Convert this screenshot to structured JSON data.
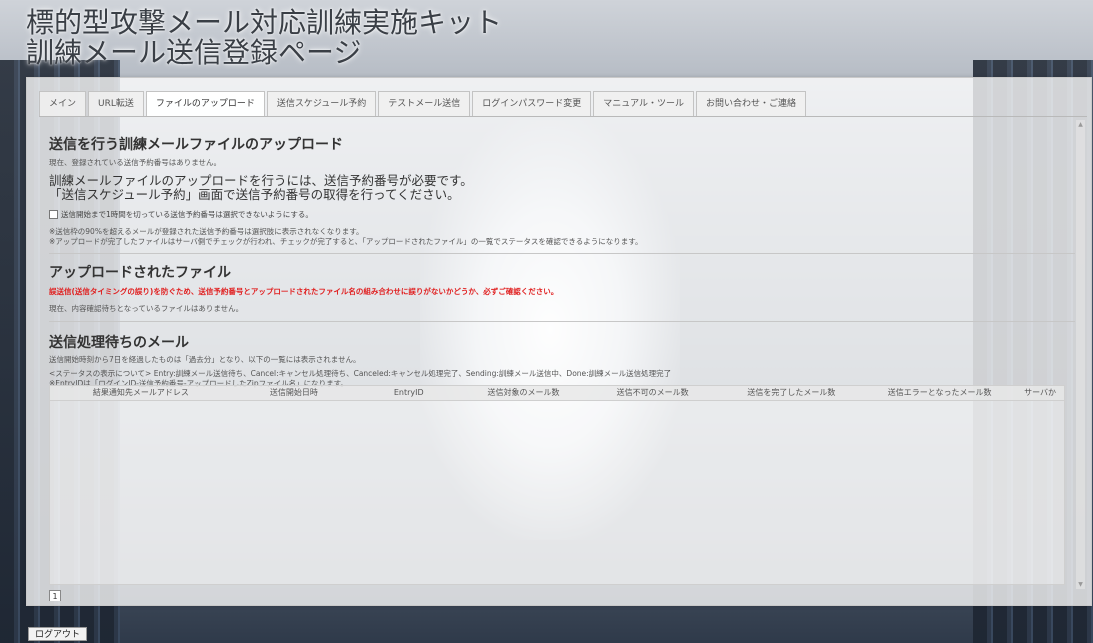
{
  "site": {
    "title_line1": "標的型攻撃メール対応訓練実施キット",
    "title_line2": "訓練メール送信登録ページ"
  },
  "tabs": [
    {
      "label": "メイン"
    },
    {
      "label": "URL転送"
    },
    {
      "label": "ファイルのアップロード",
      "active": true
    },
    {
      "label": "送信スケジュール予約"
    },
    {
      "label": "テストメール送信"
    },
    {
      "label": "ログインパスワード変更"
    },
    {
      "label": "マニュアル・ツール"
    },
    {
      "label": "お問い合わせ・ご連絡"
    }
  ],
  "upload_section": {
    "heading": "送信を行う訓練メールファイルのアップロード",
    "no_reservation": "現在、登録されている送信予約番号はありません。",
    "notice_line1": "訓練メールファイルのアップロードを行うには、送信予約番号が必要です。",
    "notice_line2": "「送信スケジュール予約」画面で送信予約番号の取得を行ってください。",
    "checkbox_label": "送信開始まで1時間を切っている送信予約番号は選択できないようにする。",
    "note1": "※送信枠の90%を超えるメールが登録された送信予約番号は選択肢に表示されなくなります。",
    "note2": "※アップロードが完了したファイルはサーバ側でチェックが行われ、チェックが完了すると、「アップロードされたファイル」の一覧でステータスを確認できるようになります。"
  },
  "uploaded_section": {
    "heading": "アップロードされたファイル",
    "warning": "誤送信(送信タイミングの誤り)を防ぐため、送信予約番号とアップロードされたファイル名の組み合わせに誤りがないかどうか、必ずご確認ください。",
    "status": "現在、内容確認待ちとなっているファイルはありません。"
  },
  "pending_section": {
    "heading": "送信処理待ちのメール",
    "note_past": "送信開始時刻から7日を経過したものは「過去分」となり、以下の一覧には表示されません。",
    "status_legend": "<ステータスの表示について> Entry:訓練メール送信待ち、Cancel:キャンセル処理待ち、Canceled:キャンセル処理完了、Sending:訓練メール送信中、Done:訓練メール送信処理完了",
    "entryid_note": "※EntryIDは「ログインID-送信予約番号-アップロードしたZipファイル名」になります。",
    "columns": [
      "結果通知先メールアドレス",
      "送信開始日時",
      "EntryID",
      "送信対象のメール数",
      "送信不可のメール数",
      "送信を完了したメール数",
      "送信エラーとなったメール数",
      "サーバか"
    ],
    "page_number": "1"
  },
  "footer": {
    "logout_label": "ログアウト"
  }
}
